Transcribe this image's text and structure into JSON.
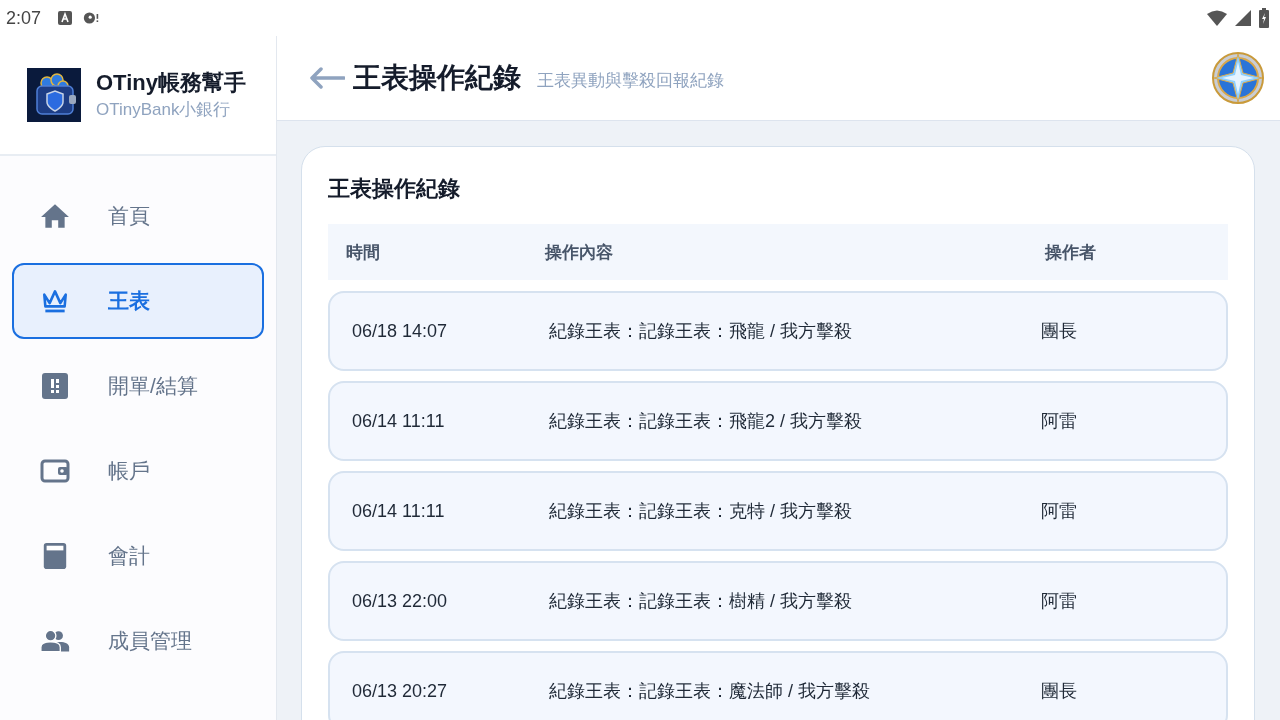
{
  "status_bar": {
    "time": "2:07"
  },
  "sidebar": {
    "app_name": "OTiny帳務幫手",
    "app_subtitle": "OTinyBank小銀行",
    "items": [
      {
        "label": "首頁",
        "kind": "home",
        "selected": false
      },
      {
        "label": "王表",
        "kind": "crown",
        "selected": true
      },
      {
        "label": "開單/結算",
        "kind": "alert",
        "selected": false
      },
      {
        "label": "帳戶",
        "kind": "wallet",
        "selected": false
      },
      {
        "label": "會計",
        "kind": "calculator",
        "selected": false
      },
      {
        "label": "成員管理",
        "kind": "people",
        "selected": false
      }
    ]
  },
  "header": {
    "title": "王表操作紀錄",
    "subtitle": "王表異動與擊殺回報紀錄"
  },
  "card": {
    "title": "王表操作紀錄",
    "table": {
      "columns": [
        "時間",
        "操作內容",
        "操作者"
      ],
      "rows": [
        [
          "06/18 14:07",
          "紀錄王表：記錄王表：飛龍 / 我方擊殺",
          "團長"
        ],
        [
          "06/14 11:11",
          "紀錄王表：記錄王表：飛龍2 / 我方擊殺",
          "阿雷"
        ],
        [
          "06/14 11:11",
          "紀錄王表：記錄王表：克特 / 我方擊殺",
          "阿雷"
        ],
        [
          "06/13 22:00",
          "紀錄王表：記錄王表：樹精 / 我方擊殺",
          "阿雷"
        ],
        [
          "06/13 20:27",
          "紀錄王表：記錄王表：魔法師 / 我方擊殺",
          "團長"
        ]
      ]
    }
  }
}
